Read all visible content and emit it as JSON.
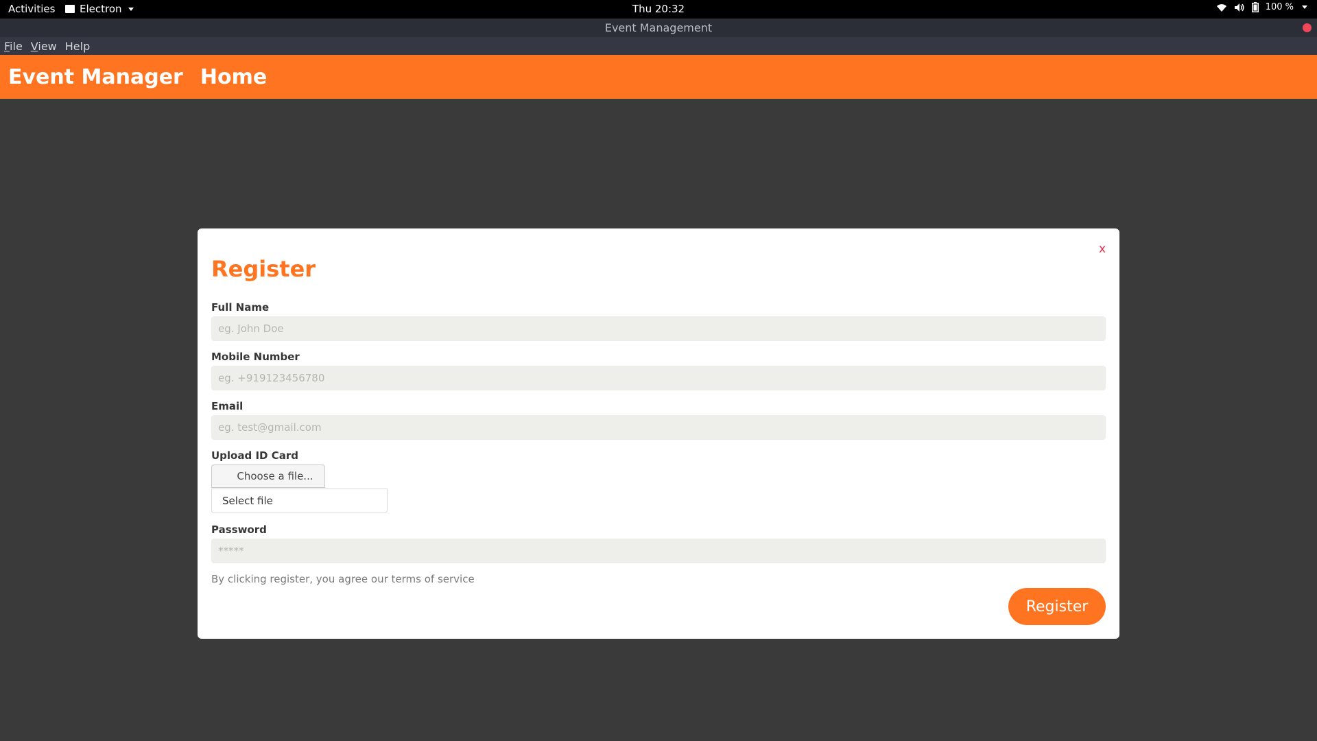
{
  "system": {
    "activities": "Activities",
    "app_name": "Electron",
    "clock": "Thu 20:32",
    "battery": "100 %"
  },
  "window": {
    "title": "Event Management"
  },
  "menubar": {
    "items": [
      {
        "label": "File",
        "mnemonic": "F",
        "rest": "ile"
      },
      {
        "label": "View",
        "mnemonic": "V",
        "rest": "iew"
      },
      {
        "label": "Help",
        "mnemonic": "",
        "rest": "Help"
      }
    ]
  },
  "header": {
    "brand": "Event Manager",
    "nav_home": "Home"
  },
  "modal": {
    "close": "x",
    "title": "Register",
    "full_name": {
      "label": "Full Name",
      "placeholder": "eg. John Doe",
      "value": ""
    },
    "mobile": {
      "label": "Mobile Number",
      "placeholder": "eg. +919123456780",
      "value": ""
    },
    "email": {
      "label": "Email",
      "placeholder": "eg. test@gmail.com",
      "value": ""
    },
    "upload": {
      "label": "Upload ID Card",
      "button": "Choose a file...",
      "filename": "Select file"
    },
    "password": {
      "label": "Password",
      "placeholder": "*****",
      "value": ""
    },
    "terms": "By clicking register, you agree our terms of service",
    "submit": "Register"
  },
  "colors": {
    "accent": "#ff7420",
    "background": "#3a3a3a",
    "close": "#e8284a"
  }
}
